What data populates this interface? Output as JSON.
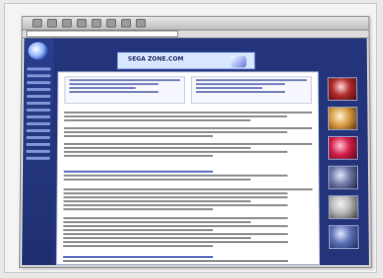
{
  "browser": {
    "address": "",
    "toolbar_buttons": [
      "",
      "",
      "",
      "",
      "",
      "",
      "",
      ""
    ]
  },
  "site": {
    "title": "",
    "banner_text": "SEGA ZONE.COM"
  },
  "content": {
    "left_column_title": "",
    "right_column_title": "",
    "section_link": ""
  },
  "sidebar": {
    "nav_items": [
      "",
      "",
      "",
      "",
      "",
      "",
      "",
      "",
      "",
      "",
      "",
      "",
      "",
      ""
    ]
  },
  "thumbnails": [
    "",
    "",
    "",
    "",
    "",
    ""
  ],
  "colors": {
    "page_bg": "#23347a",
    "content_bg": "#ffffff",
    "banner_bg": "#d8e7ff"
  }
}
